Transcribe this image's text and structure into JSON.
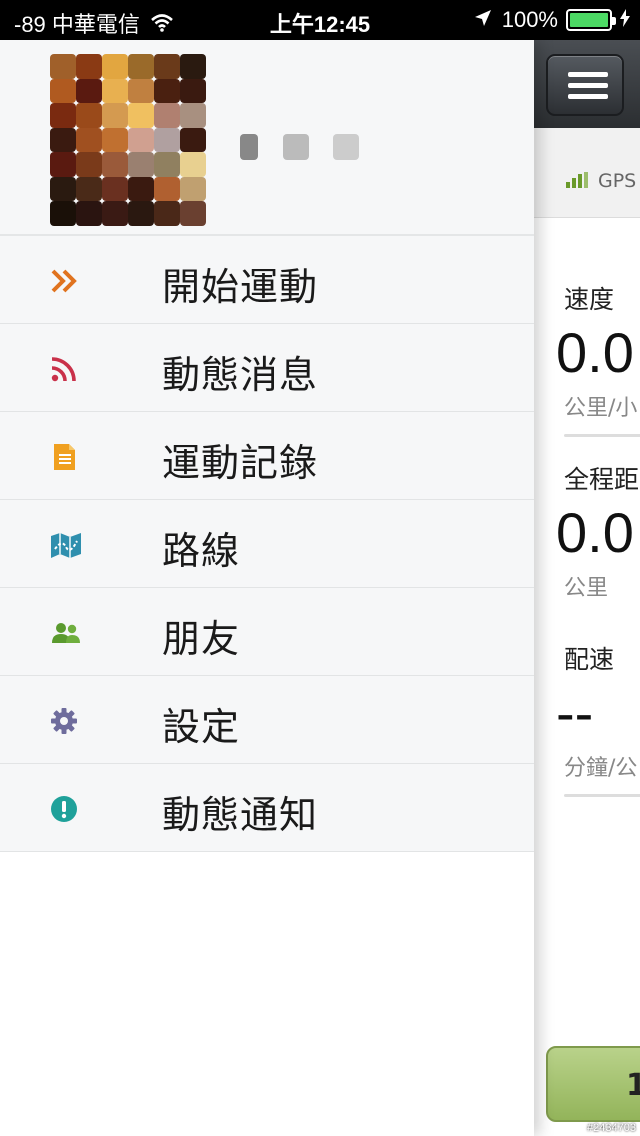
{
  "status_bar": {
    "carrier": "-89 中華電信",
    "time": "上午12:45",
    "battery_percent": "100%",
    "battery_level": 1.0,
    "battery_color": "#4cd964"
  },
  "drawer": {
    "profile": {
      "avatar_icon": "avatar-pixelated",
      "name_blurred": true
    },
    "menu_items": [
      {
        "label": "開始運動",
        "icon": "double-chevron-right-icon",
        "color": "#e0731f"
      },
      {
        "label": "動態消息",
        "icon": "rss-feed-icon",
        "color": "#c9314a"
      },
      {
        "label": "運動記錄",
        "icon": "document-icon",
        "color": "#f0a020"
      },
      {
        "label": "路線",
        "icon": "map-icon",
        "color": "#2f8fae"
      },
      {
        "label": "朋友",
        "icon": "friends-icon",
        "color": "#5a9a2e"
      },
      {
        "label": "設定",
        "icon": "gear-icon",
        "color": "#6e6c9c"
      },
      {
        "label": "動態通知",
        "icon": "alert-circle-icon",
        "color": "#1fa19a"
      }
    ]
  },
  "main": {
    "gps_label": "GPS",
    "stats": [
      {
        "label": "速度",
        "value": "0.0",
        "unit": "公里/小"
      },
      {
        "label": "全程距",
        "value": "0.0",
        "unit": "公里"
      },
      {
        "label": "配速",
        "value": "--",
        "unit": "分鐘/公"
      }
    ],
    "start_button_label": "1",
    "accent_green": "#93b45a"
  },
  "watermark": "#2434703"
}
